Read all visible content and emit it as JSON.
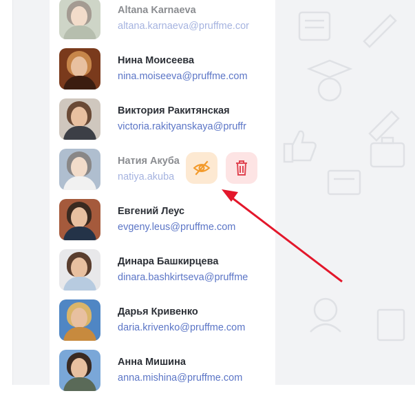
{
  "colors": {
    "name_text": "#2b2f36",
    "email_text": "#5b75c6",
    "hide_button_bg": "#fde9d2",
    "hide_icon": "#f39a2b",
    "delete_button_bg": "#fde4e4",
    "delete_icon": "#e0434f",
    "annotation_arrow": "#e3172b",
    "page_pattern_bg": "#f2f3f5"
  },
  "members": [
    {
      "name": "Altana Karnaeva",
      "email": "altana.karnaeva@pruffme.cor",
      "faded": true,
      "avatar": {
        "bg": "#a7b39a",
        "hair": "#5a4a3a",
        "body": "#7c8a6c"
      }
    },
    {
      "name": "Нина Моисеева",
      "email": "nina.moiseeva@pruffme.com",
      "faded": false,
      "avatar": {
        "bg": "#7a3a1c",
        "hair": "#c7864a",
        "body": "#3b1d10"
      }
    },
    {
      "name": "Виктория Ракитянская",
      "email": "victoria.rakityanskaya@pruffr",
      "faded": false,
      "avatar": {
        "bg": "#cfc7be",
        "hair": "#6a4a36",
        "body": "#3c3f46"
      }
    },
    {
      "name": "Натия Акуба",
      "email": "natiya.akuba",
      "faded": true,
      "avatar": {
        "bg": "#6f8aa8",
        "hair": "#2a2626",
        "body": "#e6e6e6"
      }
    },
    {
      "name": "Евгений Леус",
      "email": "evgeny.leus@pruffme.com",
      "faded": false,
      "avatar": {
        "bg": "#a55a3c",
        "hair": "#3a2a20",
        "body": "#243348"
      }
    },
    {
      "name": "Динара Башкирцева",
      "email": "dinara.bashkirtseva@pruffme",
      "faded": false,
      "avatar": {
        "bg": "#e8e8ea",
        "hair": "#5a3e2e",
        "body": "#b7cbe0"
      }
    },
    {
      "name": "Дарья Кривенко",
      "email": "daria.krivenko@pruffme.com",
      "faded": false,
      "avatar": {
        "bg": "#4f86c4",
        "hair": "#d9b56a",
        "body": "#c78a3e"
      }
    },
    {
      "name": "Анна Мишина",
      "email": "anna.mishina@pruffme.com",
      "faded": false,
      "avatar": {
        "bg": "#7aa7d8",
        "hair": "#3a2a22",
        "body": "#5a6a58"
      }
    }
  ],
  "actions": {
    "hide_icon": "eye-slash-icon",
    "delete_icon": "trash-icon"
  }
}
